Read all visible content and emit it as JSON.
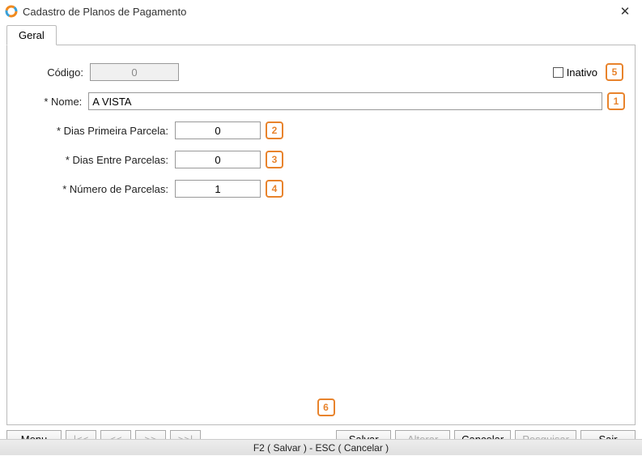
{
  "window": {
    "title": "Cadastro de Planos de Pagamento"
  },
  "tab": {
    "geral": "Geral"
  },
  "labels": {
    "codigo": "Código:",
    "nome": "* Nome:",
    "dias_primeira": "* Dias Primeira Parcela:",
    "dias_entre": "* Dias Entre Parcelas:",
    "num_parcelas": "* Número de Parcelas:",
    "inativo": "Inativo"
  },
  "values": {
    "codigo": "0",
    "nome": "A VISTA",
    "dias_primeira": "0",
    "dias_entre": "0",
    "num_parcelas": "1"
  },
  "annotations": {
    "nome": "1",
    "dias_primeira": "2",
    "dias_entre": "3",
    "num_parcelas": "4",
    "inativo": "5",
    "center": "6"
  },
  "buttons": {
    "menu": "Menu",
    "nav_first": "|<<",
    "nav_prev": "<<",
    "nav_next": ">>",
    "nav_last": ">>|",
    "salvar": "Salvar",
    "alterar": "Alterar",
    "cancelar": "Cancelar",
    "pesquisar": "Pesquisar",
    "sair": "Sair"
  },
  "status": "F2 ( Salvar )  -  ESC ( Cancelar )"
}
